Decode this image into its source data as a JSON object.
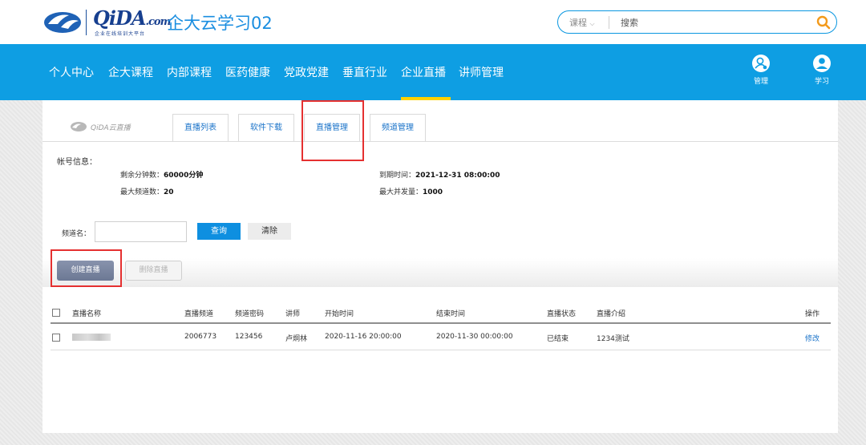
{
  "header": {
    "logo_brand": "QiDA",
    "logo_suffix": ".com",
    "logo_tagline": "企业在线培训大平台",
    "site_title": "企大云学习02",
    "search": {
      "type": "课程",
      "placeholder": "搜索"
    }
  },
  "nav": {
    "items": [
      "个人中心",
      "企大课程",
      "内部课程",
      "医药健康",
      "党政党建",
      "垂直行业",
      "企业直播",
      "讲师管理"
    ],
    "active": "企业直播",
    "manage_label": "管理",
    "study_label": "学习"
  },
  "live": {
    "logo_text": "QiDA云直播",
    "tabs": [
      "直播列表",
      "软件下载",
      "直播管理",
      "频道管理"
    ],
    "info_label": "帐号信息：",
    "remaining_label": "剩余分钟数：",
    "remaining_value": "60000分钟",
    "max_channels_label": "最大频道数：",
    "max_channels_value": "20",
    "expire_label": "到期时间：",
    "expire_value": "2021-12-31 08:00:00",
    "max_concurrency_label": "最大并发量：",
    "max_concurrency_value": "1000",
    "channel_label": "频道名：",
    "channel_value": "",
    "query_button": "查询",
    "clear_button": "清除",
    "create_button": "创建直播",
    "delete_button": "删除直播"
  },
  "table": {
    "columns": [
      "直播名称",
      "直播频道",
      "频道密码",
      "讲师",
      "开始时间",
      "结束时间",
      "直播状态",
      "直播介绍",
      "操作"
    ],
    "rows": [
      {
        "channel": "2006773",
        "password": "123456",
        "teacher": "卢炯林",
        "start": "2020-11-16 20:00:00",
        "end": "2020-11-30 00:00:00",
        "status": "已结束",
        "intro": "1234测试",
        "action": "修改"
      }
    ]
  },
  "colors": {
    "nav_bg": "#0e9ee3",
    "nav_active_underline": "#ffd200",
    "accent_blue": "#0e8fe0",
    "highlight_red": "#e53030"
  }
}
